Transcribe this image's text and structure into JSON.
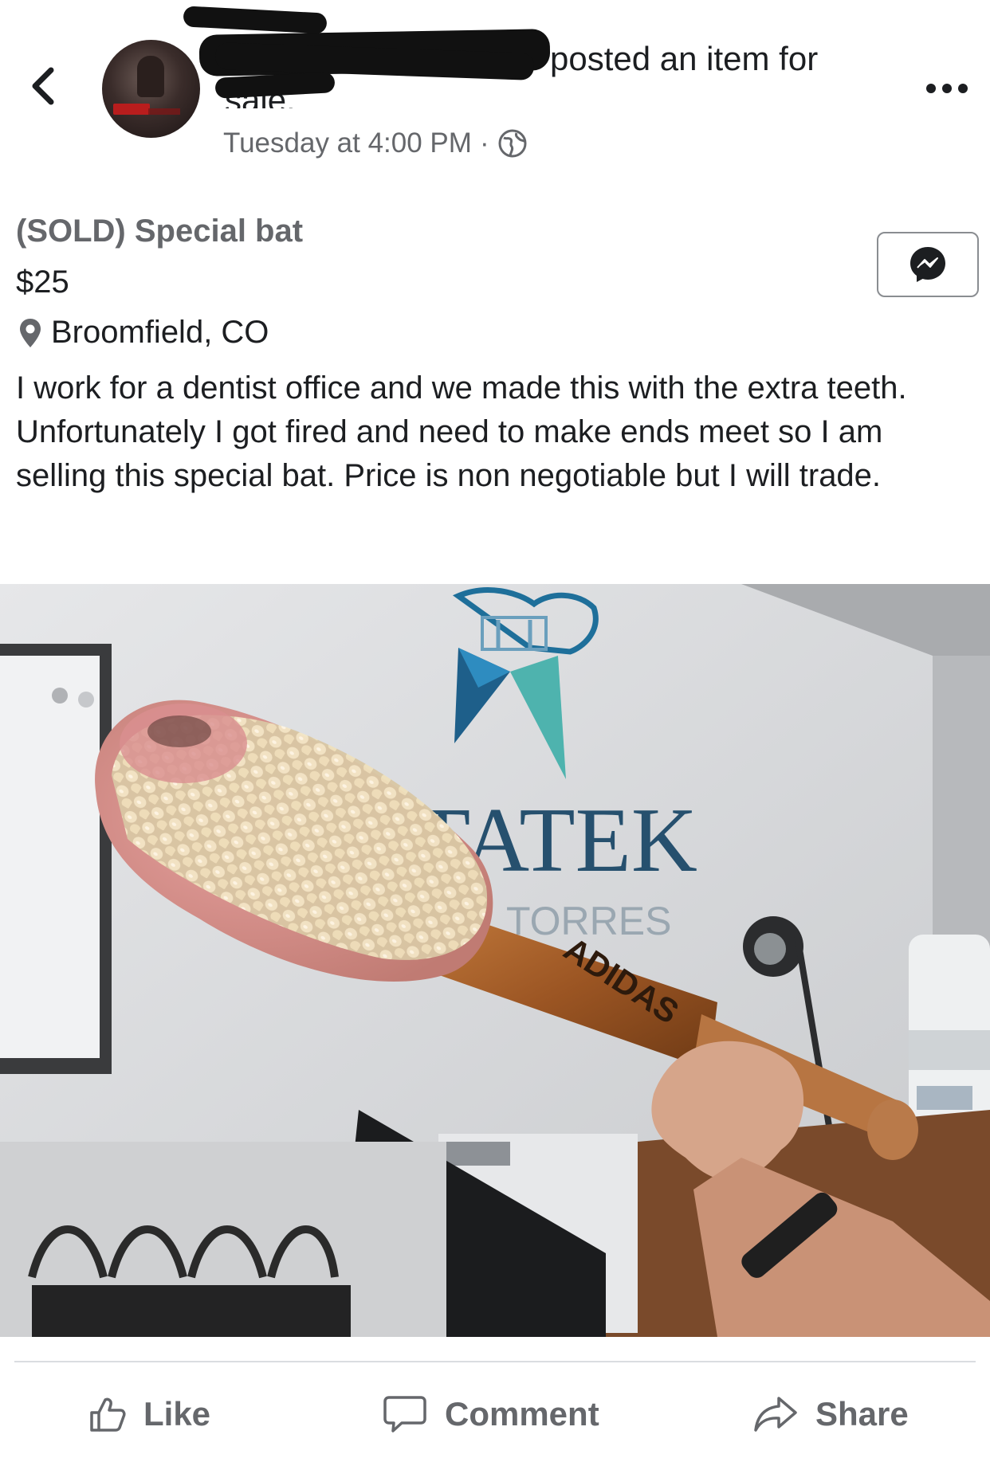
{
  "post": {
    "action_text_line1": "posted an item for",
    "action_text_line2": "sale.",
    "timestamp": "Tuesday at 4:00 PM",
    "separator": "·"
  },
  "listing": {
    "title": "(SOLD) Special bat",
    "price": "$25",
    "location": "Broomfield, CO",
    "description": "I work for a dentist office and we made this with the extra teeth. Unfortunately I got fired and need to make ends meet so I am selling this special bat. Price is non negotiable but I will trade."
  },
  "photo": {
    "sign_text": "TATEK",
    "sign_subtext": "TORRES",
    "bat_brand": "ADIDAS"
  },
  "actions": {
    "like": "Like",
    "comment": "Comment",
    "share": "Share"
  },
  "icons": {
    "back": "chevron-left-icon",
    "more": "more-dots-icon",
    "audience": "globe-icon",
    "location": "map-pin-icon",
    "messenger": "messenger-icon",
    "like": "thumbs-up-icon",
    "comment": "comment-bubble-icon",
    "share": "share-arrow-icon"
  },
  "colors": {
    "text_primary": "#1c1e21",
    "text_secondary": "#65676b",
    "divider": "#dadde1"
  }
}
